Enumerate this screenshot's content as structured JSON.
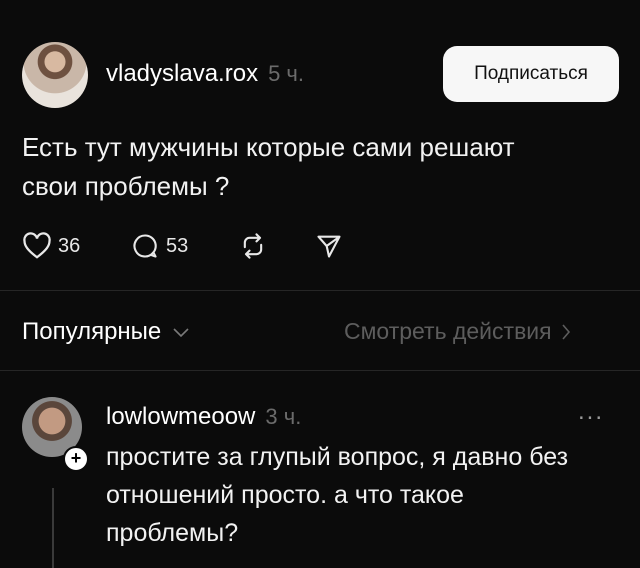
{
  "post": {
    "username": "vladyslava.rox",
    "time": "5 ч.",
    "follow_label": "Подписаться",
    "text_line1": "Есть тут мужчины которые сами решают",
    "text_line2": "свои проблемы ?",
    "likes": "36",
    "comments": "53"
  },
  "replies_header": {
    "sort_label": "Популярные",
    "see_activity_label": "Смотреть действия"
  },
  "comment": {
    "username": "lowlowmeoow",
    "time": "3 ч.",
    "more_label": "...",
    "text_line1": "простите за глупый вопрос, я давно без",
    "text_line2": "отношений просто. а что такое",
    "text_line3": "проблемы?"
  },
  "icons": [
    "heart-icon",
    "comment-icon",
    "repost-icon",
    "share-icon",
    "chevron-down-icon",
    "chevron-right-icon",
    "plus-icon",
    "more-icon"
  ]
}
